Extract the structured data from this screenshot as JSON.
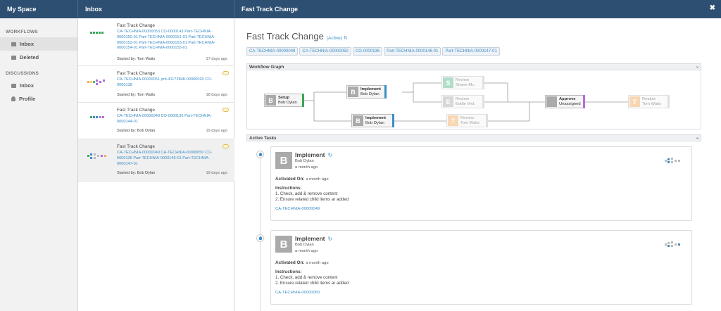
{
  "headers": {
    "my_space": "My Space",
    "inbox": "Inbox",
    "detail": "Fast Track Change"
  },
  "sidebar": {
    "workflows_label": "WORKFLOWS",
    "workflow_items": [
      {
        "label": "Inbox",
        "icon": "inbox-icon"
      },
      {
        "label": "Deleted",
        "icon": "inbox-icon"
      }
    ],
    "discussions_label": "DISCUSSIONS",
    "discussion_items": [
      {
        "label": "Inbox",
        "icon": "inbox-icon"
      },
      {
        "label": "Profile",
        "icon": "user-icon"
      }
    ]
  },
  "inbox": [
    {
      "title": "Fast Track Change",
      "links": "CA-TECHNIA-00000053 CO-0000143 Part-TECHNIA-0000150-01 Part-TECHNIA-0000151-01 Part-TECHNIA-0000152-01 Part-TECHNIA-0000153-01 Part-TECHNIA-0000154-01 Part-TECHNIA-0000155-01",
      "started": "Started by: Tom Waits",
      "date": "17 days ago"
    },
    {
      "title": "Fast Track Change",
      "links": "CA-TECHNIA-00000051 prd-41172848-00000020 CO-0000138",
      "started": "Started by: Tom Waits",
      "date": "18 days ago"
    },
    {
      "title": "Fast Track Change",
      "links": "CA-TECHNIA-00000048 CO-0000135 Part-TECHNIA-0000144-01",
      "started": "Started by: Bob Dylan",
      "date": "19 days ago"
    },
    {
      "title": "Fast Track Change",
      "links": "CA-TECHNIA-00000049 CA-TECHNIA-00000050 CO-0000136 Part-TECHNIA-0000146-01 Part-TECHNIA-0000147-01",
      "started": "Started by: Bob Dylan",
      "date": "19 days ago"
    }
  ],
  "detail": {
    "title": "Fast Track Change",
    "status": "(Active)",
    "tags": [
      "CA-TECHNIA-00000049",
      "CA-TECHNIA-00000050",
      "CO-0000136",
      "Part-TECHNIA-0000146-01",
      "Part-TECHNIA-0000147-01"
    ],
    "graph_title": "Workflow Graph",
    "nodes": [
      {
        "letter": "B",
        "name": "Setup",
        "user": "Bob Dylan"
      },
      {
        "letter": "B",
        "name": "Implement",
        "user": "Bob Dylan"
      },
      {
        "letter": "B",
        "name": "Implement",
        "user": "Bob Dylan"
      },
      {
        "letter": "S",
        "name": "Review",
        "user": "Shane Mc."
      },
      {
        "letter": "E",
        "name": "Review",
        "user": "Eddie Ved."
      },
      {
        "letter": "T",
        "name": "Review",
        "user": "Tom Waits"
      },
      {
        "letter": "",
        "name": "Approve",
        "user": "Unassigned"
      },
      {
        "letter": "T",
        "name": "Realize",
        "user": "Tom Waits"
      }
    ],
    "tasks_title": "Active Tasks",
    "tasks": [
      {
        "avatar": "B",
        "name": "Implement",
        "user": "Bob Dylan",
        "ago": "a month ago",
        "activated_label": "Activated On:",
        "activated": "a month ago",
        "instructions_label": "Instructions:",
        "inst1": "1. Check, add & remove content",
        "inst2": "2. Ensure related child items ar added",
        "link": "CA-TECHNIA-00000049"
      },
      {
        "avatar": "B",
        "name": "Implement",
        "user": "Bob Dylan",
        "ago": "a month ago",
        "activated_label": "Activated On:",
        "activated": "a month ago",
        "instructions_label": "Instructions:",
        "inst1": "1. Check, add & remove content",
        "inst2": "2. Ensure related child items ar added",
        "link": "CA-TECHNIA-00000050"
      }
    ]
  },
  "colors": {
    "header": "#2d4f72",
    "link": "#3b8dc6",
    "setup_bar": "#3aa757",
    "implement_bar": "#3b8dc6",
    "approve_bar": "#b26dd9",
    "review_green": "#53b78a",
    "review_orange": "#f2a65a"
  }
}
